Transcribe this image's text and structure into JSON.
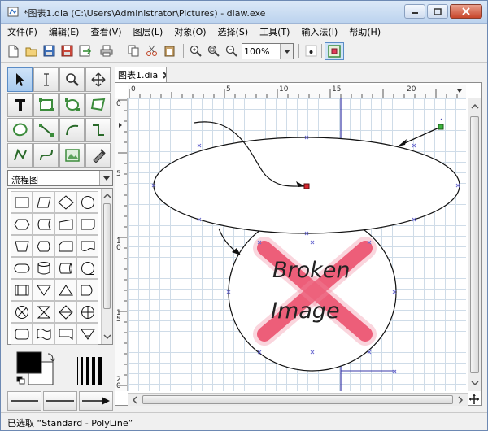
{
  "window": {
    "title": "*图表1.dia (C:\\Users\\Administrator\\Pictures) - diaw.exe"
  },
  "menu": {
    "items": [
      "文件(F)",
      "编辑(E)",
      "查看(V)",
      "图层(L)",
      "对象(O)",
      "选择(S)",
      "工具(T)",
      "输入法(I)",
      "帮助(H)"
    ]
  },
  "toolbar": {
    "zoom_value": "100%"
  },
  "toolbox": {
    "sheet_selected": "流程图"
  },
  "tab": {
    "label": "图表1.dia"
  },
  "rulers": {
    "horizontal_labels": [
      "0",
      "5",
      "10",
      "15",
      "20"
    ],
    "vertical_labels": [
      "0",
      "5",
      "1\n0",
      "1\n5",
      "2\n0"
    ]
  },
  "diagram": {
    "broken_image_line1": "Broken",
    "broken_image_line2": "Image"
  },
  "status": {
    "text": "已选取 “Standard - PolyLine”"
  },
  "colors": {
    "grid": "#cfdce8",
    "selection_blue": "#5a8cc6",
    "broken_cross": "#e8284a",
    "guide_line": "#3a3aa8"
  }
}
